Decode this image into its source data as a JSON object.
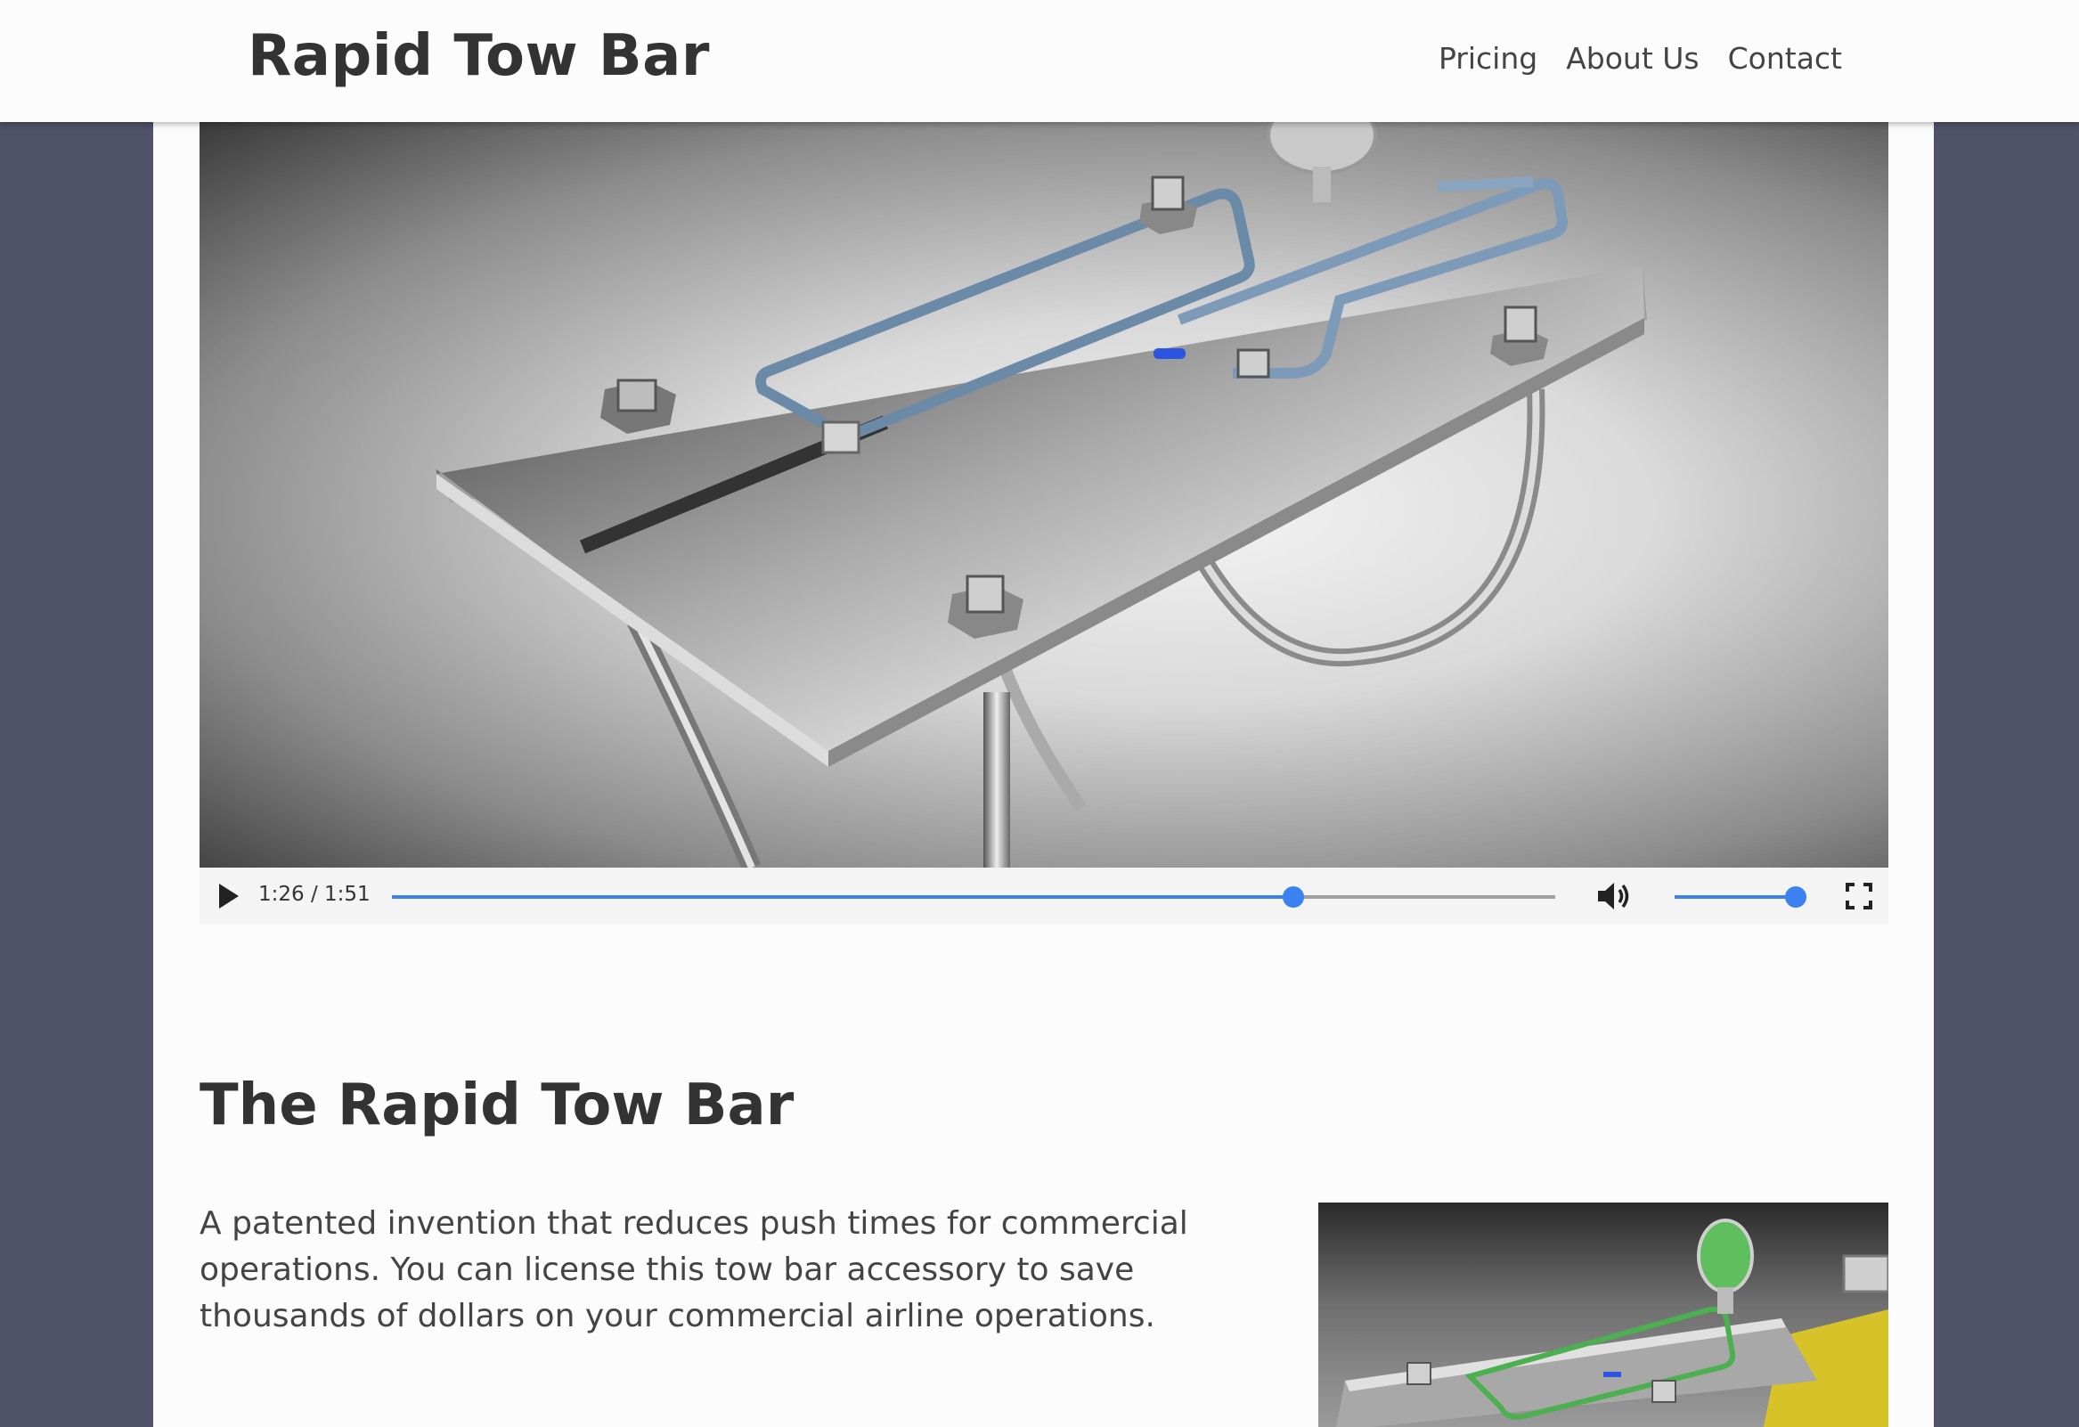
{
  "brand": {
    "title": "Rapid Tow Bar"
  },
  "nav": {
    "items": [
      {
        "label": "Pricing"
      },
      {
        "label": "About Us"
      },
      {
        "label": "Contact"
      }
    ]
  },
  "video": {
    "time": "1:26 / 1:51",
    "progress_fraction": 0.775,
    "volume_fraction": 0.97
  },
  "section": {
    "title": "The Rapid Tow Bar",
    "body": "A patented invention that reduces push times for commercial operations. You can license this tow bar accessory to save thousands of dollars on your commercial airline operations."
  },
  "colors": {
    "background": "#4f5268",
    "sheet": "#fcfcfc",
    "accent": "#3b82f0",
    "text": "#333333"
  },
  "icons": {
    "play": "play-icon",
    "volume": "volume-icon",
    "fullscreen": "fullscreen-icon"
  }
}
